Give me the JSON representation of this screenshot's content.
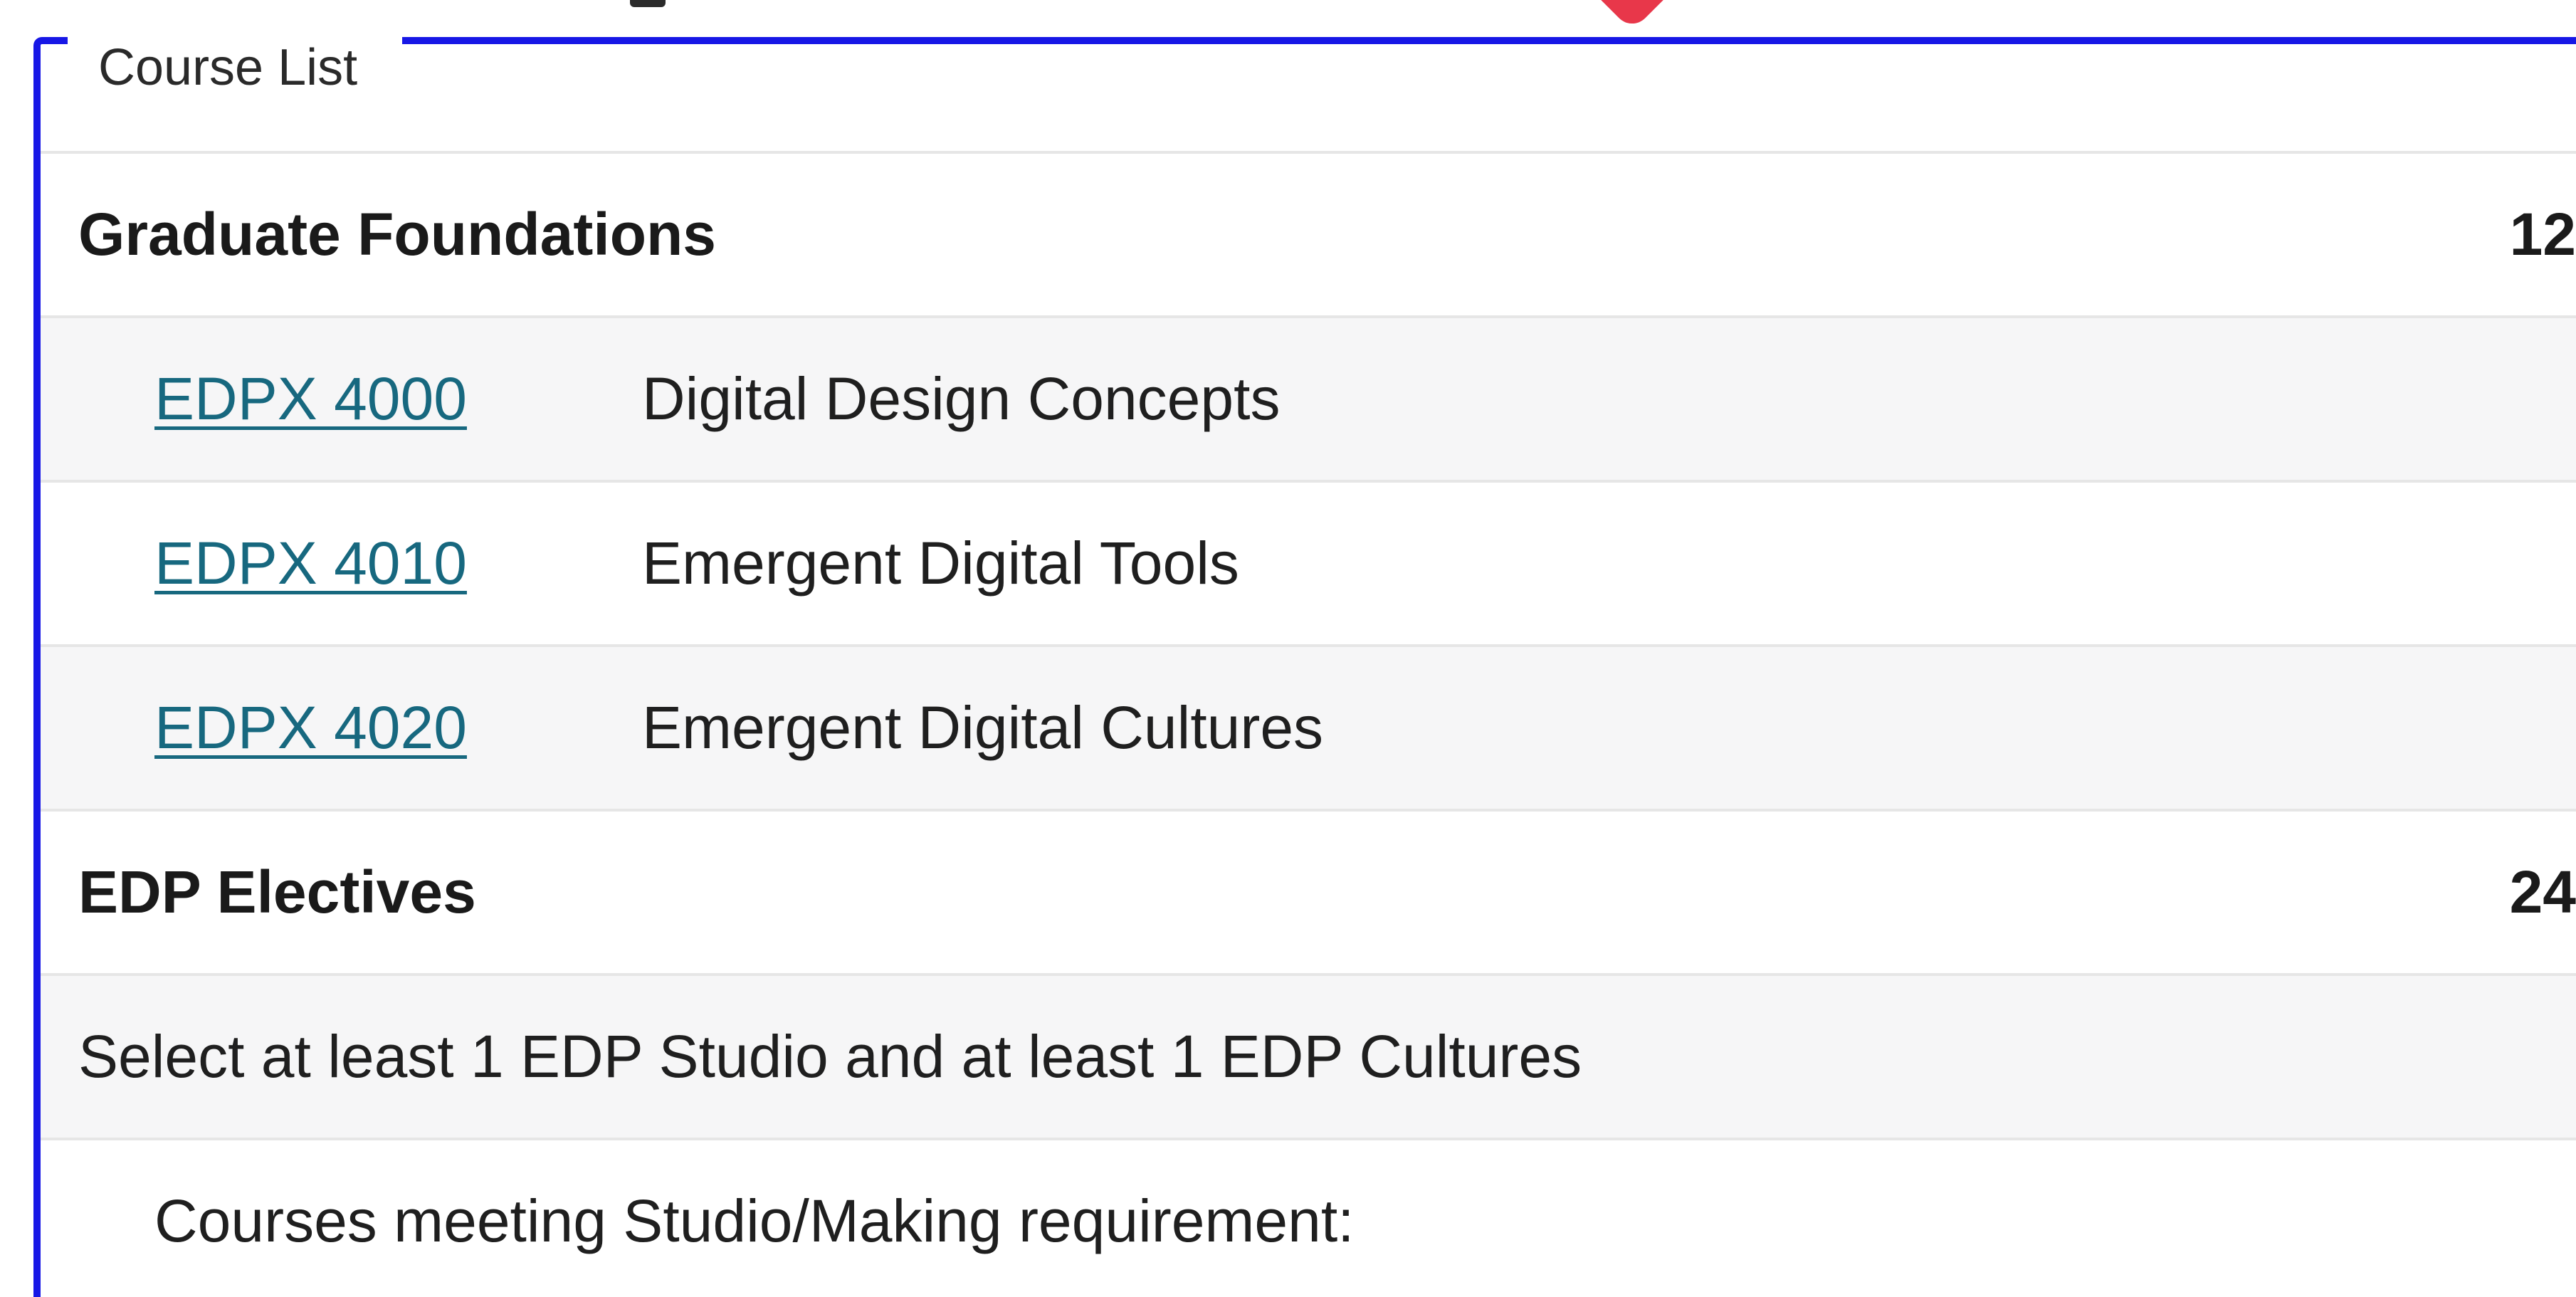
{
  "legend": "Course List",
  "colors": {
    "border_accent": "#1717e6",
    "link": "#17687f",
    "pin": "#e8374a",
    "row_alt": "#f6f6f7"
  },
  "sections": [
    {
      "title": "Graduate Foundations",
      "hours": "12",
      "courses": [
        {
          "code": "EDPX 4000",
          "title": "Digital Design Concepts"
        },
        {
          "code": "EDPX 4010",
          "title": "Emergent Digital Tools"
        },
        {
          "code": "EDPX 4020",
          "title": "Emergent Digital Cultures"
        }
      ]
    },
    {
      "title": "EDP Electives",
      "hours": "24",
      "note": "Select at least 1 EDP Studio and at least 1 EDP Cultures",
      "subheading": "Courses meeting Studio/Making requirement:"
    }
  ]
}
